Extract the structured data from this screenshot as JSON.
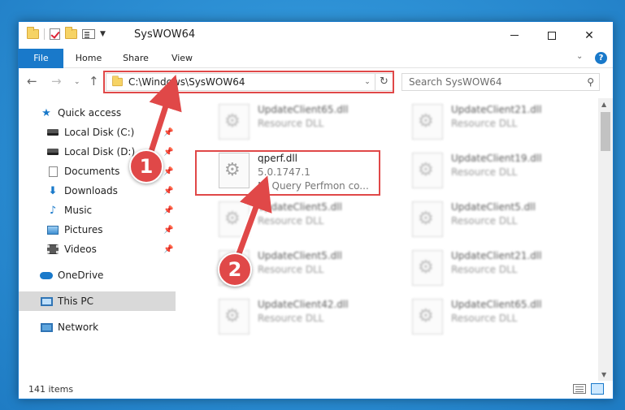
{
  "window": {
    "title": "SysWOW64"
  },
  "ribbon": {
    "tabs": [
      "File",
      "Home",
      "Share",
      "View"
    ]
  },
  "navigation": {
    "address": "C:\\Windows\\SysWOW64",
    "search_placeholder": "Search SysWOW64"
  },
  "sidebar": {
    "quick_access": "Quick access",
    "items": [
      {
        "label": "Local Disk (C:)",
        "icon": "drive-icon"
      },
      {
        "label": "Local Disk (D:)",
        "icon": "drive-icon"
      },
      {
        "label": "Documents",
        "icon": "documents-icon"
      },
      {
        "label": "Downloads",
        "icon": "downloads-icon"
      },
      {
        "label": "Music",
        "icon": "music-icon"
      },
      {
        "label": "Pictures",
        "icon": "pictures-icon"
      },
      {
        "label": "Videos",
        "icon": "videos-icon"
      }
    ],
    "onedrive": "OneDrive",
    "this_pc": "This PC",
    "network": "Network"
  },
  "files": {
    "highlighted": {
      "name": "qperf.dll",
      "version": "5.0.1747.1",
      "description": "Nt Query Perfmon co..."
    },
    "others": [
      {
        "name": "UpdateClient65.dll",
        "type": "Resource DLL"
      },
      {
        "name": "UpdateClient21.dll",
        "type": "Resource DLL"
      },
      {
        "name": "UpdateClient19.dll",
        "type": "Resource DLL"
      },
      {
        "name": "UpdateClient5.dll",
        "type": "Resource DLL"
      },
      {
        "name": "UpdateClient5.dll",
        "type": "Resource DLL"
      },
      {
        "name": "UpdateClient5.dll",
        "type": "Resource DLL"
      },
      {
        "name": "UpdateClient21.dll",
        "type": "Resource DLL"
      },
      {
        "name": "UpdateClient42.dll",
        "type": "Resource DLL"
      },
      {
        "name": "UpdateClient65.dll",
        "type": "Resource DLL"
      }
    ]
  },
  "status": {
    "item_count": "141 items"
  },
  "callouts": [
    "1",
    "2"
  ],
  "colors": {
    "accent": "#1979ca",
    "highlight": "#e04848"
  }
}
